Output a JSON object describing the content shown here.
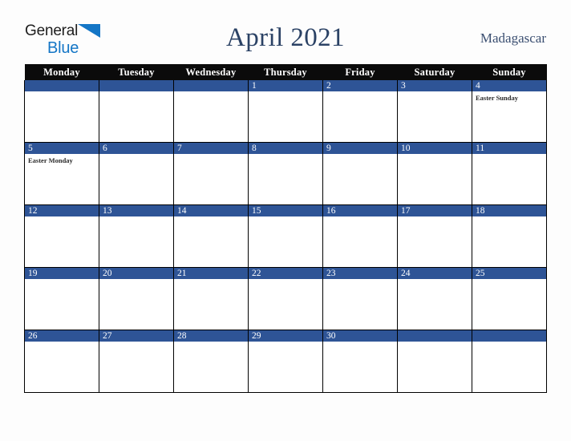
{
  "brand": {
    "name_part1": "General",
    "name_part2": "Blue",
    "triangle_icon": "triangle-icon",
    "color_dark": "#1d1d1d",
    "color_blue": "#1476c6"
  },
  "header": {
    "title": "April 2021",
    "country": "Madagascar",
    "title_color": "#2b4265"
  },
  "calendar": {
    "month": "April",
    "year": "2021",
    "first_day_of_week": "Monday",
    "header_bg": "#0b0b0b",
    "daynum_bg": "#2e5496",
    "weekdays": [
      "Monday",
      "Tuesday",
      "Wednesday",
      "Thursday",
      "Friday",
      "Saturday",
      "Sunday"
    ],
    "weeks": [
      [
        {
          "day": "",
          "events": []
        },
        {
          "day": "",
          "events": []
        },
        {
          "day": "",
          "events": []
        },
        {
          "day": "1",
          "events": []
        },
        {
          "day": "2",
          "events": []
        },
        {
          "day": "3",
          "events": []
        },
        {
          "day": "4",
          "events": [
            "Easter Sunday"
          ]
        }
      ],
      [
        {
          "day": "5",
          "events": [
            "Easter Monday"
          ]
        },
        {
          "day": "6",
          "events": []
        },
        {
          "day": "7",
          "events": []
        },
        {
          "day": "8",
          "events": []
        },
        {
          "day": "9",
          "events": []
        },
        {
          "day": "10",
          "events": []
        },
        {
          "day": "11",
          "events": []
        }
      ],
      [
        {
          "day": "12",
          "events": []
        },
        {
          "day": "13",
          "events": []
        },
        {
          "day": "14",
          "events": []
        },
        {
          "day": "15",
          "events": []
        },
        {
          "day": "16",
          "events": []
        },
        {
          "day": "17",
          "events": []
        },
        {
          "day": "18",
          "events": []
        }
      ],
      [
        {
          "day": "19",
          "events": []
        },
        {
          "day": "20",
          "events": []
        },
        {
          "day": "21",
          "events": []
        },
        {
          "day": "22",
          "events": []
        },
        {
          "day": "23",
          "events": []
        },
        {
          "day": "24",
          "events": []
        },
        {
          "day": "25",
          "events": []
        }
      ],
      [
        {
          "day": "26",
          "events": []
        },
        {
          "day": "27",
          "events": []
        },
        {
          "day": "28",
          "events": []
        },
        {
          "day": "29",
          "events": []
        },
        {
          "day": "30",
          "events": []
        },
        {
          "day": "",
          "events": []
        },
        {
          "day": "",
          "events": []
        }
      ]
    ]
  }
}
